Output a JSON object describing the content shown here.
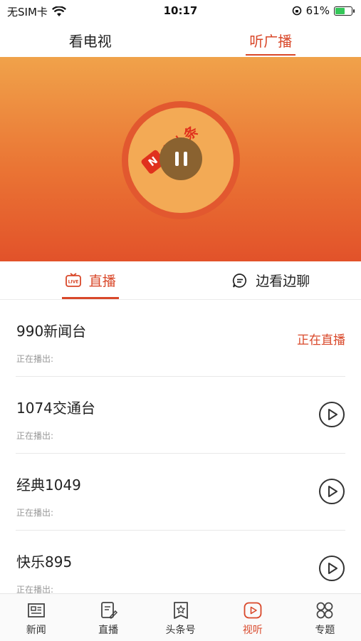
{
  "status_bar": {
    "carrier": "无SIM卡",
    "time": "10:17",
    "battery_percent": "61%",
    "battery_level": 0.61,
    "icons": [
      "wifi-icon",
      "rotation-lock-icon",
      "battery-icon"
    ]
  },
  "top_tabs": [
    {
      "label": "看电视",
      "active": false
    },
    {
      "label": "听广播",
      "active": true
    }
  ],
  "player": {
    "logo_text": "宁头条",
    "state": "playing",
    "pause_icon": "pause-icon"
  },
  "sub_tabs": [
    {
      "label": "直播",
      "icon": "live-tv-icon",
      "active": true
    },
    {
      "label": "边看边聊",
      "icon": "chat-bubble-icon",
      "active": false
    }
  ],
  "stations": [
    {
      "name": "990新闻台",
      "now_playing_label": "正在播出:",
      "status": "正在直播"
    },
    {
      "name": "1074交通台",
      "now_playing_label": "正在播出:",
      "status": ""
    },
    {
      "name": "经典1049",
      "now_playing_label": "正在播出:",
      "status": ""
    },
    {
      "name": "快乐895",
      "now_playing_label": "正在播出:",
      "status": ""
    }
  ],
  "bottom_nav": [
    {
      "label": "新闻",
      "icon": "newspaper-icon",
      "active": false
    },
    {
      "label": "直播",
      "icon": "live-doc-icon",
      "active": false
    },
    {
      "label": "头条号",
      "icon": "star-bookmark-icon",
      "active": false
    },
    {
      "label": "视听",
      "icon": "play-video-icon",
      "active": true
    },
    {
      "label": "专题",
      "icon": "grid-apps-icon",
      "active": false
    }
  ],
  "colors": {
    "accent": "#d9482a",
    "hero_top": "#f0a24a",
    "hero_bottom": "#e2522a"
  }
}
